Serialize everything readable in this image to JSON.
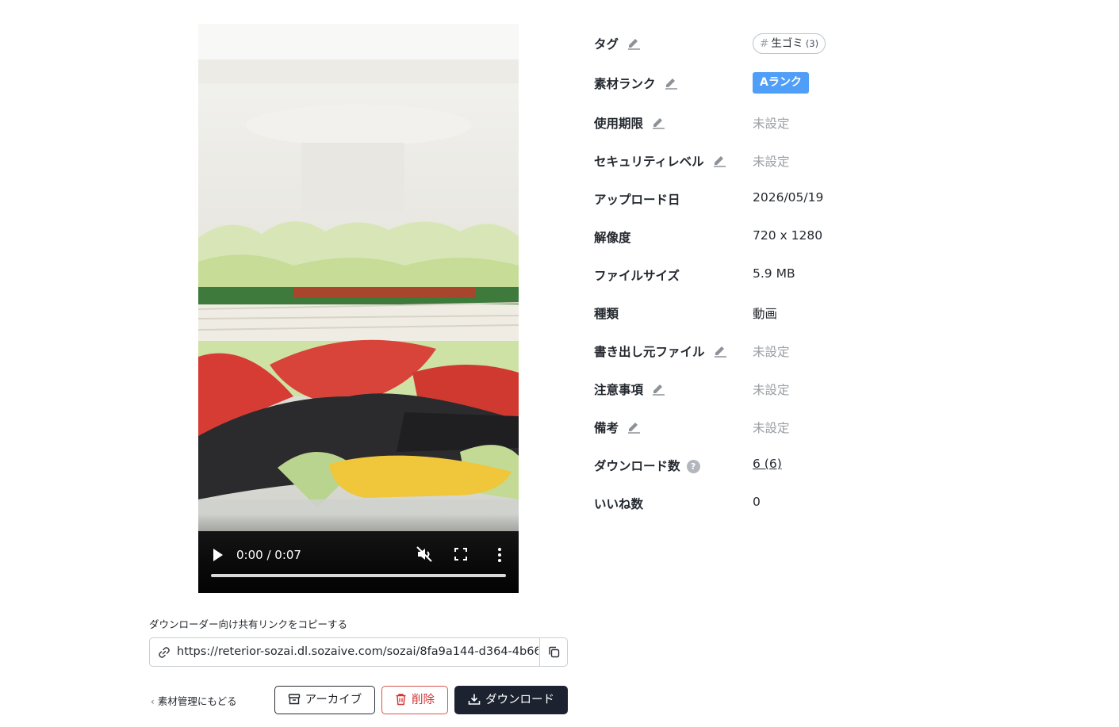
{
  "video": {
    "current_time": "0:00",
    "duration": "0:07",
    "time_separator": " / ",
    "progress": 0.0
  },
  "share": {
    "label": "ダウンローダー向け共有リンクをコピーする",
    "url": "https://reterior-sozai.dl.sozaive.com/sozai/8fa9a144-d364-4b66-"
  },
  "actions": {
    "back_label": "素材管理にもどる",
    "archive_label": "アーカイブ",
    "delete_label": "削除",
    "download_label": "ダウンロード"
  },
  "details": {
    "tag": {
      "label": "タグ",
      "name": "生ゴミ",
      "count": "(3)"
    },
    "rank": {
      "label": "素材ランク",
      "value": "Aランク"
    },
    "expiry": {
      "label": "使用期限",
      "value": "未設定"
    },
    "security": {
      "label": "セキュリティレベル",
      "value": "未設定"
    },
    "upload_date": {
      "label": "アップロード日",
      "value": "2026/05/19"
    },
    "resolution": {
      "label": "解像度",
      "value": "720 x 1280"
    },
    "file_size": {
      "label": "ファイルサイズ",
      "value": "5.9 MB"
    },
    "kind": {
      "label": "種類",
      "value": "動画"
    },
    "source_file": {
      "label": "書き出し元ファイル",
      "value": "未設定"
    },
    "notes": {
      "label": "注意事項",
      "value": "未設定"
    },
    "remarks": {
      "label": "備考",
      "value": "未設定"
    },
    "downloads": {
      "label": "ダウンロード数",
      "value": "6 (6)",
      "help": "?"
    },
    "likes": {
      "label": "いいね数",
      "value": "0"
    }
  },
  "colors": {
    "rank_badge": "#4f9ef8",
    "delete": "#d32f2f",
    "download_bg": "#1c2230",
    "muted": "#9aa0a6"
  },
  "icons": [
    "pencil-icon",
    "link-icon",
    "copy-icon",
    "archive-icon",
    "trash-icon",
    "download-icon",
    "play-icon",
    "mute-icon",
    "fullscreen-icon",
    "more-icon",
    "help-icon",
    "chevron-left-icon"
  ]
}
